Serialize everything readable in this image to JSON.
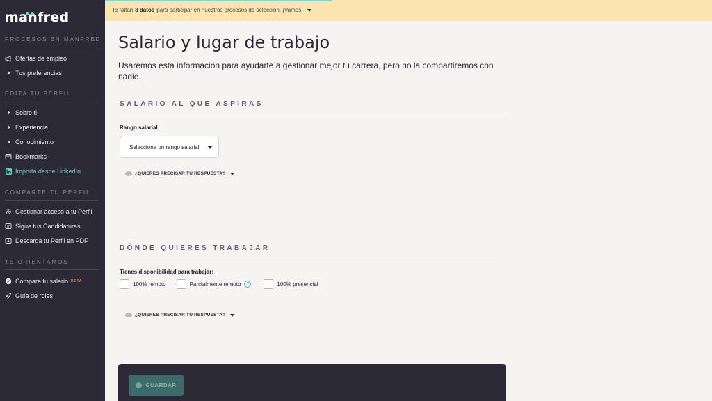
{
  "sidebar": {
    "logo": "manfred",
    "sections": [
      {
        "title": "PROCESOS EN MANFRED",
        "items": [
          {
            "label": "Ofertas de empleo",
            "icon": "megaphone-icon"
          },
          {
            "label": "Tus preferencias",
            "icon": "caret-right-icon"
          }
        ]
      },
      {
        "title": "EDITA TU PERFIL",
        "items": [
          {
            "label": "Sobre ti",
            "icon": "caret-right-icon"
          },
          {
            "label": "Experiencia",
            "icon": "caret-right-icon"
          },
          {
            "label": "Conocimiento",
            "icon": "caret-right-icon"
          },
          {
            "label": "Bookmarks",
            "icon": "bookmark-icon"
          },
          {
            "label": "Importa desde LinkedIn",
            "icon": "linkedin-icon"
          }
        ]
      },
      {
        "title": "COMPARTE TU PERFIL",
        "items": [
          {
            "label": "Gestionar acceso a tu Perfil",
            "icon": "gear-icon"
          },
          {
            "label": "Sigue tus Candidaturas",
            "icon": "tracking-icon"
          },
          {
            "label": "Descarga tu Perfil en PDF",
            "icon": "pdf-icon"
          }
        ]
      },
      {
        "title": "TE ORIENTAMOS",
        "items": [
          {
            "label": "Compara tu salario",
            "icon": "compass-icon",
            "badge": "BETA"
          },
          {
            "label": "Guía de roles",
            "icon": "rocket-icon"
          }
        ]
      }
    ]
  },
  "banner": {
    "prefix": "Te faltan",
    "count": "8 datos",
    "suffix": "para participar en nuestros procesos de selección. ¡Vamos!",
    "progress": 0.375
  },
  "main": {
    "title": "Salario y lugar de trabajo",
    "description": "Usaremos esta información para ayudarte a gestionar mejor tu carrera, pero no la compartiremos con nadie.",
    "salary_section": {
      "heading": "SALARIO AL QUE ASPIRAS",
      "field_label": "Rango salarial",
      "select_value": "Selecciona un rango salarial",
      "refine_label": "¿QUIERES PRECISAR TU RESPUESTA?"
    },
    "location_section": {
      "heading": "DÓNDE QUIERES TRABAJAR",
      "field_label": "Tienes disponibilidad para trabajar:",
      "options": [
        "100% remoto",
        "Parcialmente remoto",
        "100% presencial"
      ],
      "refine_label": "¿QUIERES PRECISAR TU RESPUESTA?"
    },
    "save_label": "GUARDAR"
  },
  "colors": {
    "sidebar_bg": "#2b2a36",
    "banner_bg": "#fbe4b0",
    "accent": "#7fd8c2",
    "linkedin": "#6cc7c8",
    "beta": "#f0b429"
  }
}
